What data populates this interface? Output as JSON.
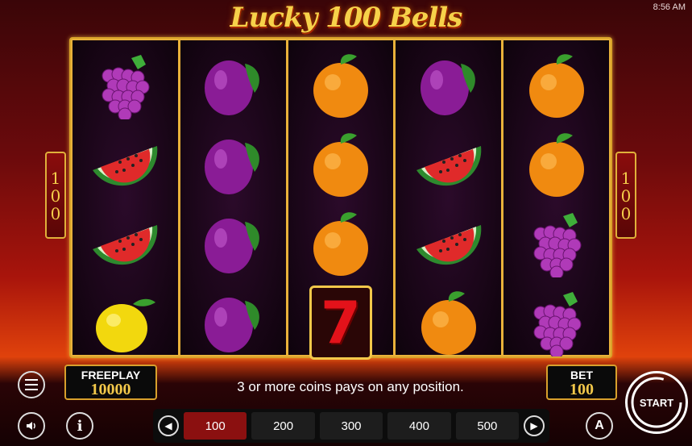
{
  "status_bar": {
    "time": "8:56 AM"
  },
  "game": {
    "title": "Lucky 100 Bells",
    "lines": "100"
  },
  "reels": [
    [
      "grapes",
      "watermelon",
      "watermelon",
      "lemon"
    ],
    [
      "plum",
      "plum",
      "plum",
      "plum"
    ],
    [
      "orange",
      "orange",
      "orange",
      "seven"
    ],
    [
      "plum",
      "watermelon",
      "watermelon",
      "orange"
    ],
    [
      "orange",
      "orange",
      "grapes",
      "grapes"
    ]
  ],
  "seven_label": "7",
  "freeplay": {
    "label": "FREEPLAY",
    "value": "10000"
  },
  "bet": {
    "label": "BET",
    "value": "100"
  },
  "message": "3 or more coins pays on any position.",
  "bet_options": [
    "100",
    "200",
    "300",
    "400",
    "500"
  ],
  "selected_bet": "100",
  "controls": {
    "start_label": "START",
    "autoplay_label": "A",
    "info_label": "i"
  },
  "colors": {
    "gold": "#f2c84a",
    "selected_bet": "#8b1010",
    "frame": "#d9a32a"
  }
}
